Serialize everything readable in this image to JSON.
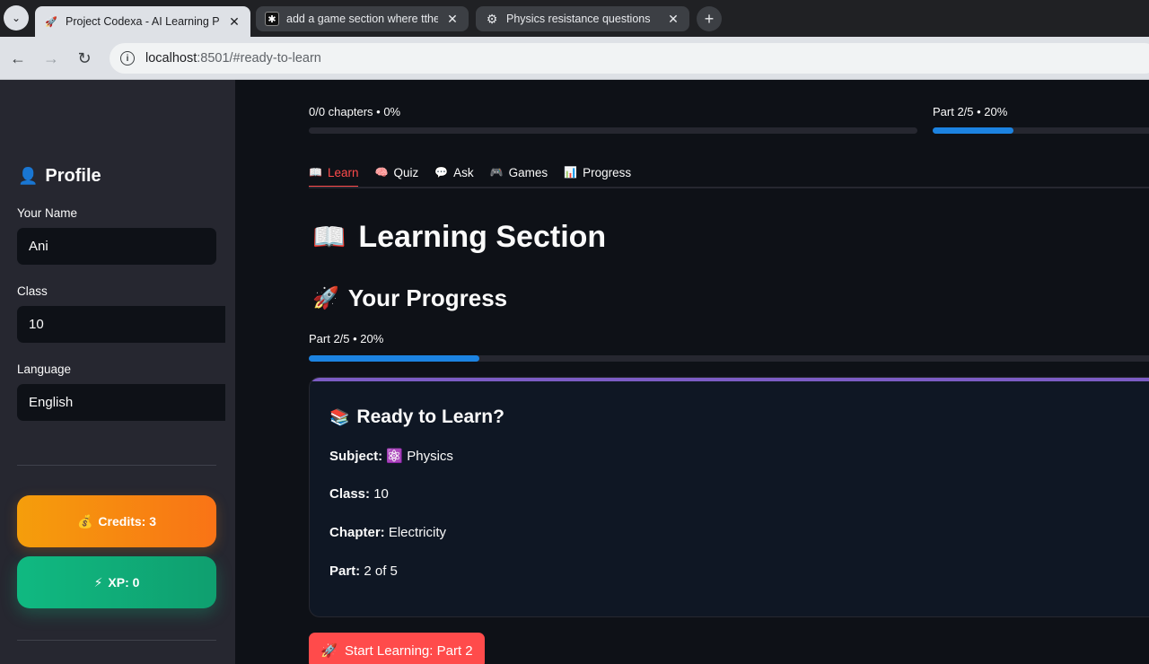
{
  "browser": {
    "tabs": [
      {
        "title": "Project Codexa - AI Learning Pla",
        "icon": "rocket-favicon",
        "active": true
      },
      {
        "title": "add a game section where tthe",
        "icon": "ai-chat-favicon",
        "active": false
      },
      {
        "title": "Physics resistance questions",
        "icon": "openai-favicon",
        "active": false
      }
    ],
    "url_host": "localhost",
    "url_rest": ":8501/#ready-to-learn"
  },
  "sidebar": {
    "profile_icon": "👤",
    "profile_heading": "Profile",
    "name_label": "Your Name",
    "name_value": "Ani",
    "class_label": "Class",
    "class_value": "10",
    "language_label": "Language",
    "language_value": "English",
    "credits_icon": "💰",
    "credits_label": "Credits: 3",
    "xp_icon": "⚡",
    "xp_label": "XP: 0"
  },
  "main": {
    "top_left_progress_text": "0/0 chapters • 0%",
    "top_left_progress": 0,
    "top_right_progress_text": "Part 2/5 • 20%",
    "top_right_progress": 0.2,
    "tabs": [
      {
        "icon": "📖",
        "label": "Learn",
        "active": true
      },
      {
        "icon": "🧠",
        "label": "Quiz",
        "active": false
      },
      {
        "icon": "💬",
        "label": "Ask",
        "active": false
      },
      {
        "icon": "🎮",
        "label": "Games",
        "active": false
      },
      {
        "icon": "📊",
        "label": "Progress",
        "active": false
      }
    ],
    "section_icon": "📖",
    "section_title": "Learning Section",
    "progress_icon": "🚀",
    "progress_heading": "Your Progress",
    "progress_text": "Part 2/5 • 20%",
    "progress_value": 0.2,
    "card": {
      "icon": "📚",
      "title": "Ready to Learn?",
      "subject_label": "Subject:",
      "subject_icon": "⚛️",
      "subject_value": "Physics",
      "class_label": "Class:",
      "class_value": "10",
      "chapter_label": "Chapter:",
      "chapter_value": "Electricity",
      "part_label": "Part:",
      "part_value": "2 of 5"
    },
    "start_icon": "🚀",
    "start_label": "Start Learning: Part 2"
  },
  "colors": {
    "accent_red": "#ff4b4b",
    "progress_blue": "#1c83e1",
    "credits_orange": "#f59e0b",
    "xp_green": "#10b981",
    "card_accent": "#7c5cc4"
  }
}
